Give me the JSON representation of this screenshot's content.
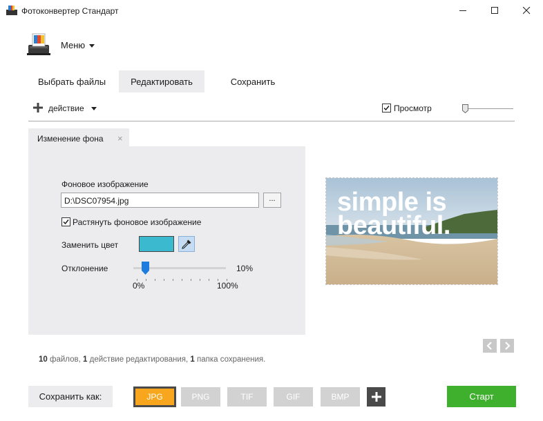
{
  "window": {
    "title": "Фотоконвертер Стандарт"
  },
  "menu": {
    "label": "Меню"
  },
  "tabs": [
    {
      "label": "Выбрать файлы",
      "active": false
    },
    {
      "label": "Редактировать",
      "active": true
    },
    {
      "label": "Сохранить",
      "active": false
    }
  ],
  "toolbar": {
    "action_label": "действие",
    "preview_label": "Просмотр",
    "preview_checked": true
  },
  "panel": {
    "tab_label": "Изменение фона",
    "close_glyph": "×",
    "bg_image_label": "Фоновое изображение",
    "bg_image_value": "D:\\DSC07954.jpg",
    "browse_label": "...",
    "stretch_label": "Растянуть фоновое изображение",
    "stretch_checked": true,
    "replace_color_label": "Заменить цвет",
    "replace_color_value": "#3ab9cf",
    "deviation_label": "Отклонение",
    "deviation_value": "10%",
    "deviation_fraction": 0.1,
    "deviation_min": "0%",
    "deviation_max": "100%"
  },
  "preview": {
    "line1": "simple is",
    "line2": "beautiful."
  },
  "status": {
    "files_count": "10",
    "files_text": "файлов,",
    "actions_count": "1",
    "actions_text": "действие редактирования,",
    "folders_count": "1",
    "folders_text": "папка сохранения."
  },
  "bottom": {
    "save_as_label": "Сохранить как:",
    "formats": [
      {
        "label": "JPG",
        "active": true
      },
      {
        "label": "PNG",
        "active": false
      },
      {
        "label": "TIF",
        "active": false
      },
      {
        "label": "GIF",
        "active": false
      },
      {
        "label": "BMP",
        "active": false
      }
    ],
    "start_label": "Старт"
  },
  "colors": {
    "accent_orange": "#f7a61d",
    "start_green": "#3fb02d",
    "swatch": "#3ab9cf"
  }
}
